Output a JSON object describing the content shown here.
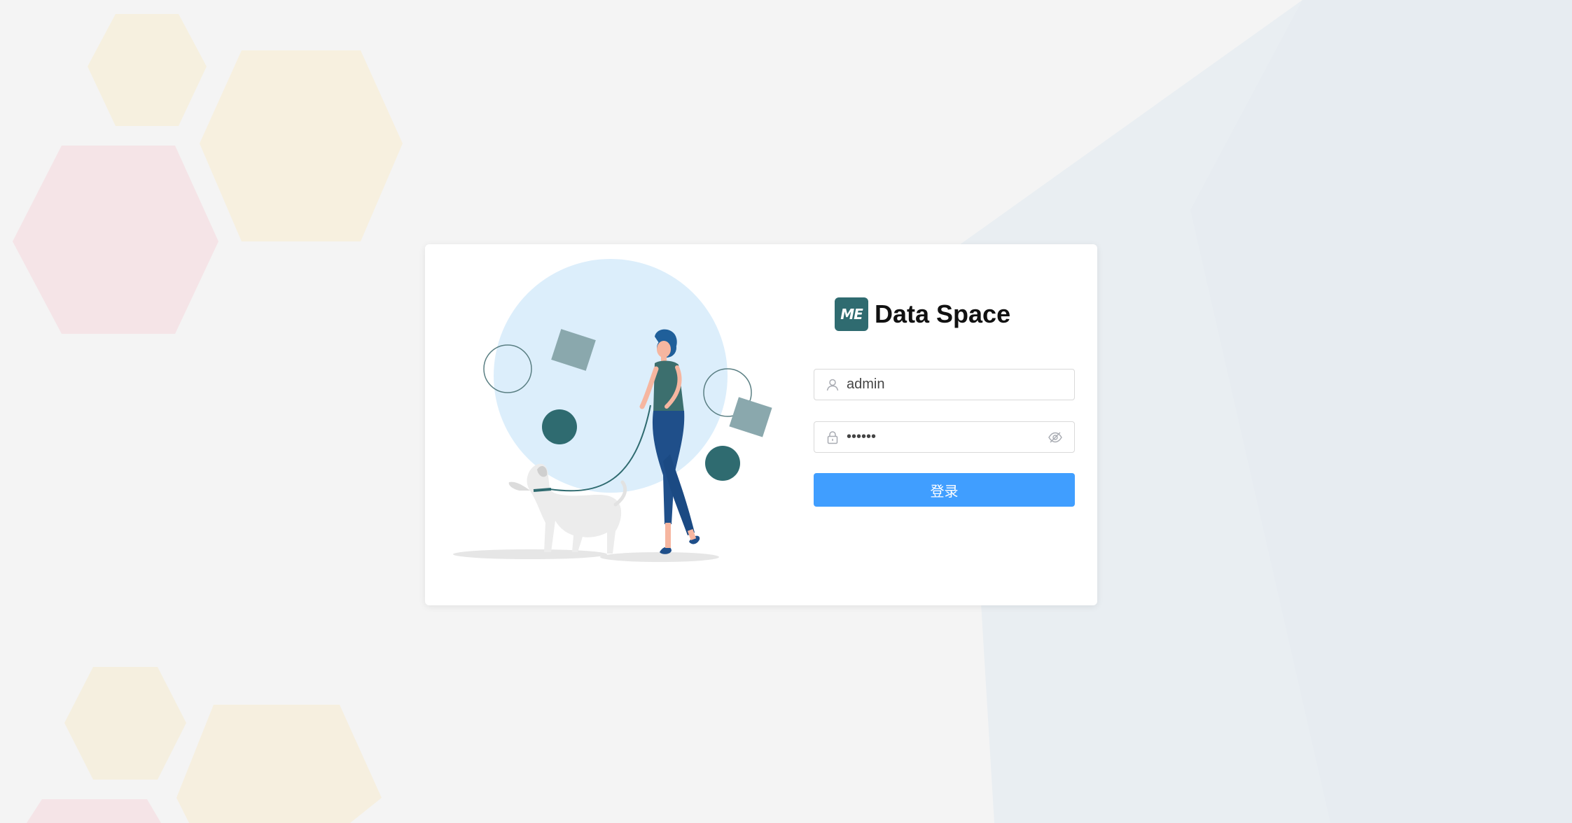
{
  "brand": {
    "logo_text": "ME",
    "title": "Data Space"
  },
  "form": {
    "username": {
      "value": "admin",
      "icon": "user-icon"
    },
    "password": {
      "value": "••••••",
      "icon": "lock-icon",
      "toggle_icon": "eye-hidden-icon"
    },
    "submit_label": "登录"
  },
  "colors": {
    "accent": "#409eff",
    "brand": "#2f6b70",
    "page_background": "#f4f4f4"
  }
}
